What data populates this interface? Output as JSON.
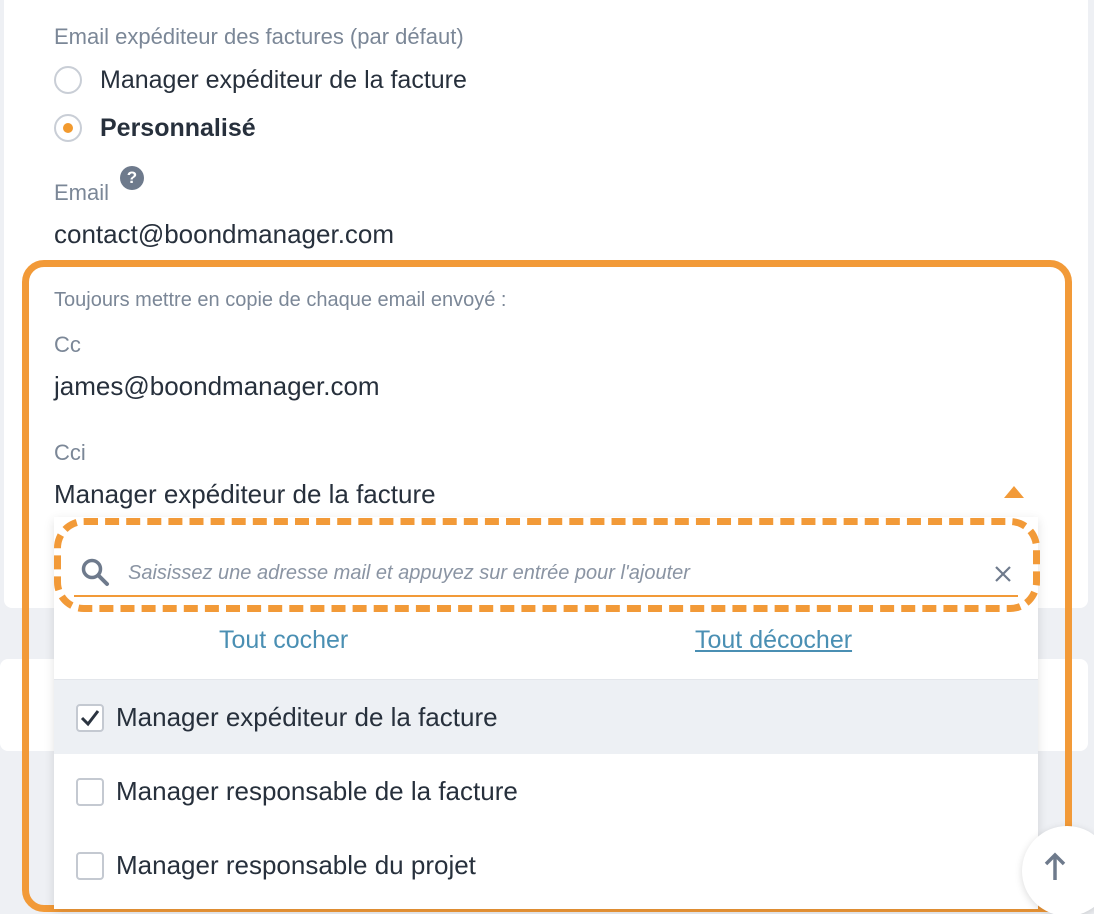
{
  "sender_section": {
    "label": "Email expéditeur des factures (par défaut)",
    "options": [
      {
        "label": "Manager expéditeur de la facture",
        "checked": false
      },
      {
        "label": "Personnalisé",
        "checked": true
      }
    ]
  },
  "email_field": {
    "label": "Email",
    "help_icon": "?",
    "value": "contact@boondmanager.com"
  },
  "copy_section": {
    "title": "Toujours mettre en copie de chaque email envoyé :",
    "cc_label": "Cc",
    "cc_value": "james@boondmanager.com",
    "cci_label": "Cci",
    "cci_value": "Manager expéditeur de la facture"
  },
  "dropdown": {
    "search_placeholder": "Saisissez une adresse mail et appuyez sur entrée pour l'ajouter",
    "check_all": "Tout cocher",
    "uncheck_all": "Tout décocher",
    "options": [
      {
        "label": "Manager expéditeur de la facture",
        "checked": true
      },
      {
        "label": "Manager responsable de la facture",
        "checked": false
      },
      {
        "label": "Manager responsable du projet",
        "checked": false
      }
    ]
  },
  "colors": {
    "accent": "#f29a38",
    "link": "#4a8fb3",
    "muted_text": "#7b8797"
  }
}
